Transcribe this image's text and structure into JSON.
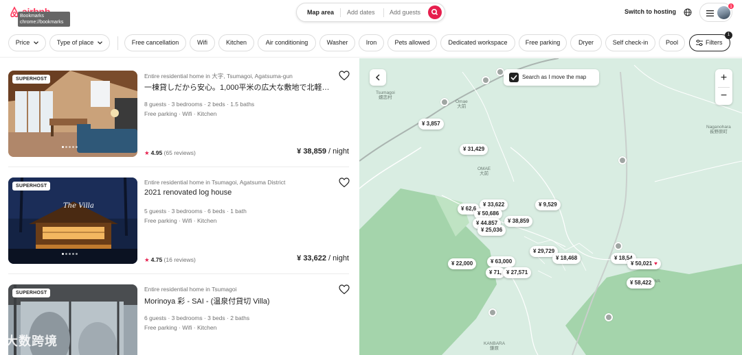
{
  "header": {
    "logo_text": "airbnb",
    "tooltip_title": "Bookmarks",
    "tooltip_url": "chrome://bookmarks",
    "search": {
      "where": "Map area",
      "dates": "Add dates",
      "guests": "Add guests"
    },
    "switch_hosting": "Switch to hosting",
    "notification_count": "1"
  },
  "filters": {
    "price": "Price",
    "type_of_place": "Type of place",
    "chips": [
      "Free cancellation",
      "Wifi",
      "Kitchen",
      "Air conditioning",
      "Washer",
      "Iron",
      "Pets allowed",
      "Dedicated workspace",
      "Free parking",
      "Dryer",
      "Self check-in",
      "Pool"
    ],
    "filters_label": "Filters",
    "filters_count": "1"
  },
  "listings": [
    {
      "badge": "SUPERHOST",
      "type": "Entire residential home in 大字, Tsumagoi, Agatsuma-gun",
      "title": "一棟貸しだから安心。1,000平米の広大な敷地で北軽…",
      "specs": "8 guests · 3 bedrooms · 2 beds · 1.5 baths",
      "amenities": "Free parking · Wifi · Kitchen",
      "rating": "4.95",
      "reviews": "(65 reviews)",
      "price": "¥ 38,859",
      "unit": " / night"
    },
    {
      "badge": "SUPERHOST",
      "type": "Entire residential home in Tsumagoi, Agatsuma District",
      "title": "2021 renovated log house",
      "specs": "5 guests · 3 bedrooms · 6 beds · 1 bath",
      "amenities": "Free parking · Wifi · Kitchen",
      "rating": "4.75",
      "reviews": "(16 reviews)",
      "price": "¥ 33,622",
      "unit": " / night",
      "photo_text": "The Villa"
    },
    {
      "badge": "SUPERHOST",
      "type": "Entire residential home in Tsumagoi",
      "title": "Morinoya 彩 - SAI - (温泉付貸切 Villa)",
      "specs": "6 guests · 3 bedrooms · 3 beds · 2 baths",
      "amenities": "Free parking · Wifi · Kitchen"
    }
  ],
  "watermark": "大数跨境",
  "map": {
    "search_as_move": "Search as I move the map",
    "zoom_in": "+",
    "zoom_out": "−",
    "place_labels": [
      "Tsumagoi\n嬬恋村",
      "Omae\n大前",
      "OMAE\n大前",
      "Naganohara\n長野原町",
      "TAKARUIZAWA\n北軽井沢",
      "KANBARA\n鎌原"
    ],
    "price_pins": [
      "¥ 3,857",
      "¥ 31,429",
      "¥ 62,6",
      "¥ 33,622",
      "¥ 50,686",
      "¥ 44,857",
      "¥ 38,859",
      "¥ 25,036",
      "¥ 9,529",
      "¥ 29,729",
      "¥ 18,468",
      "¥ 18,54",
      "¥ 50,021",
      "¥ 58,422",
      "¥ 22,000",
      "¥ 63,000",
      "¥ 71,",
      "¥ 27,571"
    ]
  }
}
